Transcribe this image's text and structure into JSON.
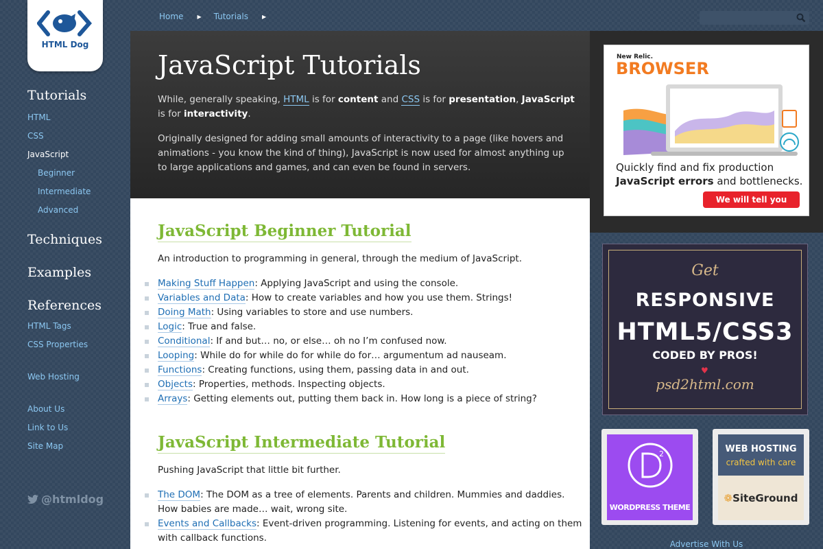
{
  "logo": {
    "text": "HTML Dog"
  },
  "breadcrumb": {
    "items": [
      "Home",
      "Tutorials"
    ]
  },
  "search": {
    "placeholder": ""
  },
  "sidebar": {
    "tutorials_heading": "Tutorials",
    "tutorials": [
      "HTML",
      "CSS",
      "JavaScript"
    ],
    "js_sub": [
      "Beginner",
      "Intermediate",
      "Advanced"
    ],
    "techniques": "Techniques",
    "examples": "Examples",
    "references": "References",
    "ref_links": [
      "HTML Tags",
      "CSS Properties"
    ],
    "web_hosting": "Web Hosting",
    "about": [
      "About Us",
      "Link to Us",
      "Site Map"
    ],
    "twitter": "@htmldog"
  },
  "hero": {
    "title": "JavaScript Tutorials",
    "p1": [
      "While, generally speaking, ",
      "HTML",
      " is for ",
      "content",
      " and ",
      "CSS",
      " is for ",
      "presentation",
      ", ",
      "JavaScript",
      " is for ",
      "interactivity",
      "."
    ],
    "p2": "Originally designed for adding small amounts of interactivity to a page (like hovers and animations - you know the kind of thing), JavaScript is now used for almost anything up to large applications and games, and can even be found in servers."
  },
  "beginner": {
    "title": "JavaScript Beginner Tutorial",
    "intro": "An introduction to programming in general, through the medium of JavaScript.",
    "items": [
      {
        "link": "Making Stuff Happen",
        "desc": ": Applying JavaScript and using the console."
      },
      {
        "link": "Variables and Data",
        "desc": ": How to create variables and how you use them. Strings!"
      },
      {
        "link": "Doing Math",
        "desc": ": Using variables to store and use numbers."
      },
      {
        "link": "Logic",
        "desc": ": True and false."
      },
      {
        "link": "Conditional",
        "desc": ": If and but… no, or else… oh no I’m confused now."
      },
      {
        "link": "Looping",
        "desc": ": While do for while do for while do for… argumentum ad nauseam."
      },
      {
        "link": "Functions",
        "desc": ": Creating functions, using them, passing data in and out."
      },
      {
        "link": "Objects",
        "desc": ": Properties, methods. Inspecting objects."
      },
      {
        "link": "Arrays",
        "desc": ": Getting elements out, putting them back in. How long is a piece of string?"
      }
    ]
  },
  "intermediate": {
    "title": "JavaScript Intermediate Tutorial",
    "intro": "Pushing JavaScript that little bit further.",
    "items": [
      {
        "link": "The DOM",
        "desc": ": The DOM as a tree of elements. Parents and children. Mummies and daddies. How babies are made… wait, wrong site."
      },
      {
        "link": "Events and Callbacks",
        "desc": ": Event-driven programming. Listening for events, and acting on them with callback functions."
      }
    ]
  },
  "ads": {
    "newrelic": {
      "brand": "New Relic.",
      "product": "BROWSER",
      "copy_a": "Quickly find and fix production",
      "copy_b": "JavaScript errors",
      "copy_c": " and bottlenecks.",
      "button": "We will tell you"
    },
    "psd": {
      "get": "Get",
      "line1": "RESPONSIVE",
      "line2": "HTML5/CSS3",
      "line3": "CODED BY PROS!",
      "line4": "psd2html.com"
    },
    "divi": {
      "text": "WORDPRESS THEME"
    },
    "siteground": {
      "t1": "WEB HOSTING",
      "t2": "crafted with care",
      "logo": "SiteGround"
    },
    "advertise": "Advertise With Us"
  },
  "colors": {
    "accent_green": "#7eb835",
    "link_blue": "#1e6eb4",
    "sidebar_link": "#8cc8f2",
    "background": "#33475e"
  }
}
